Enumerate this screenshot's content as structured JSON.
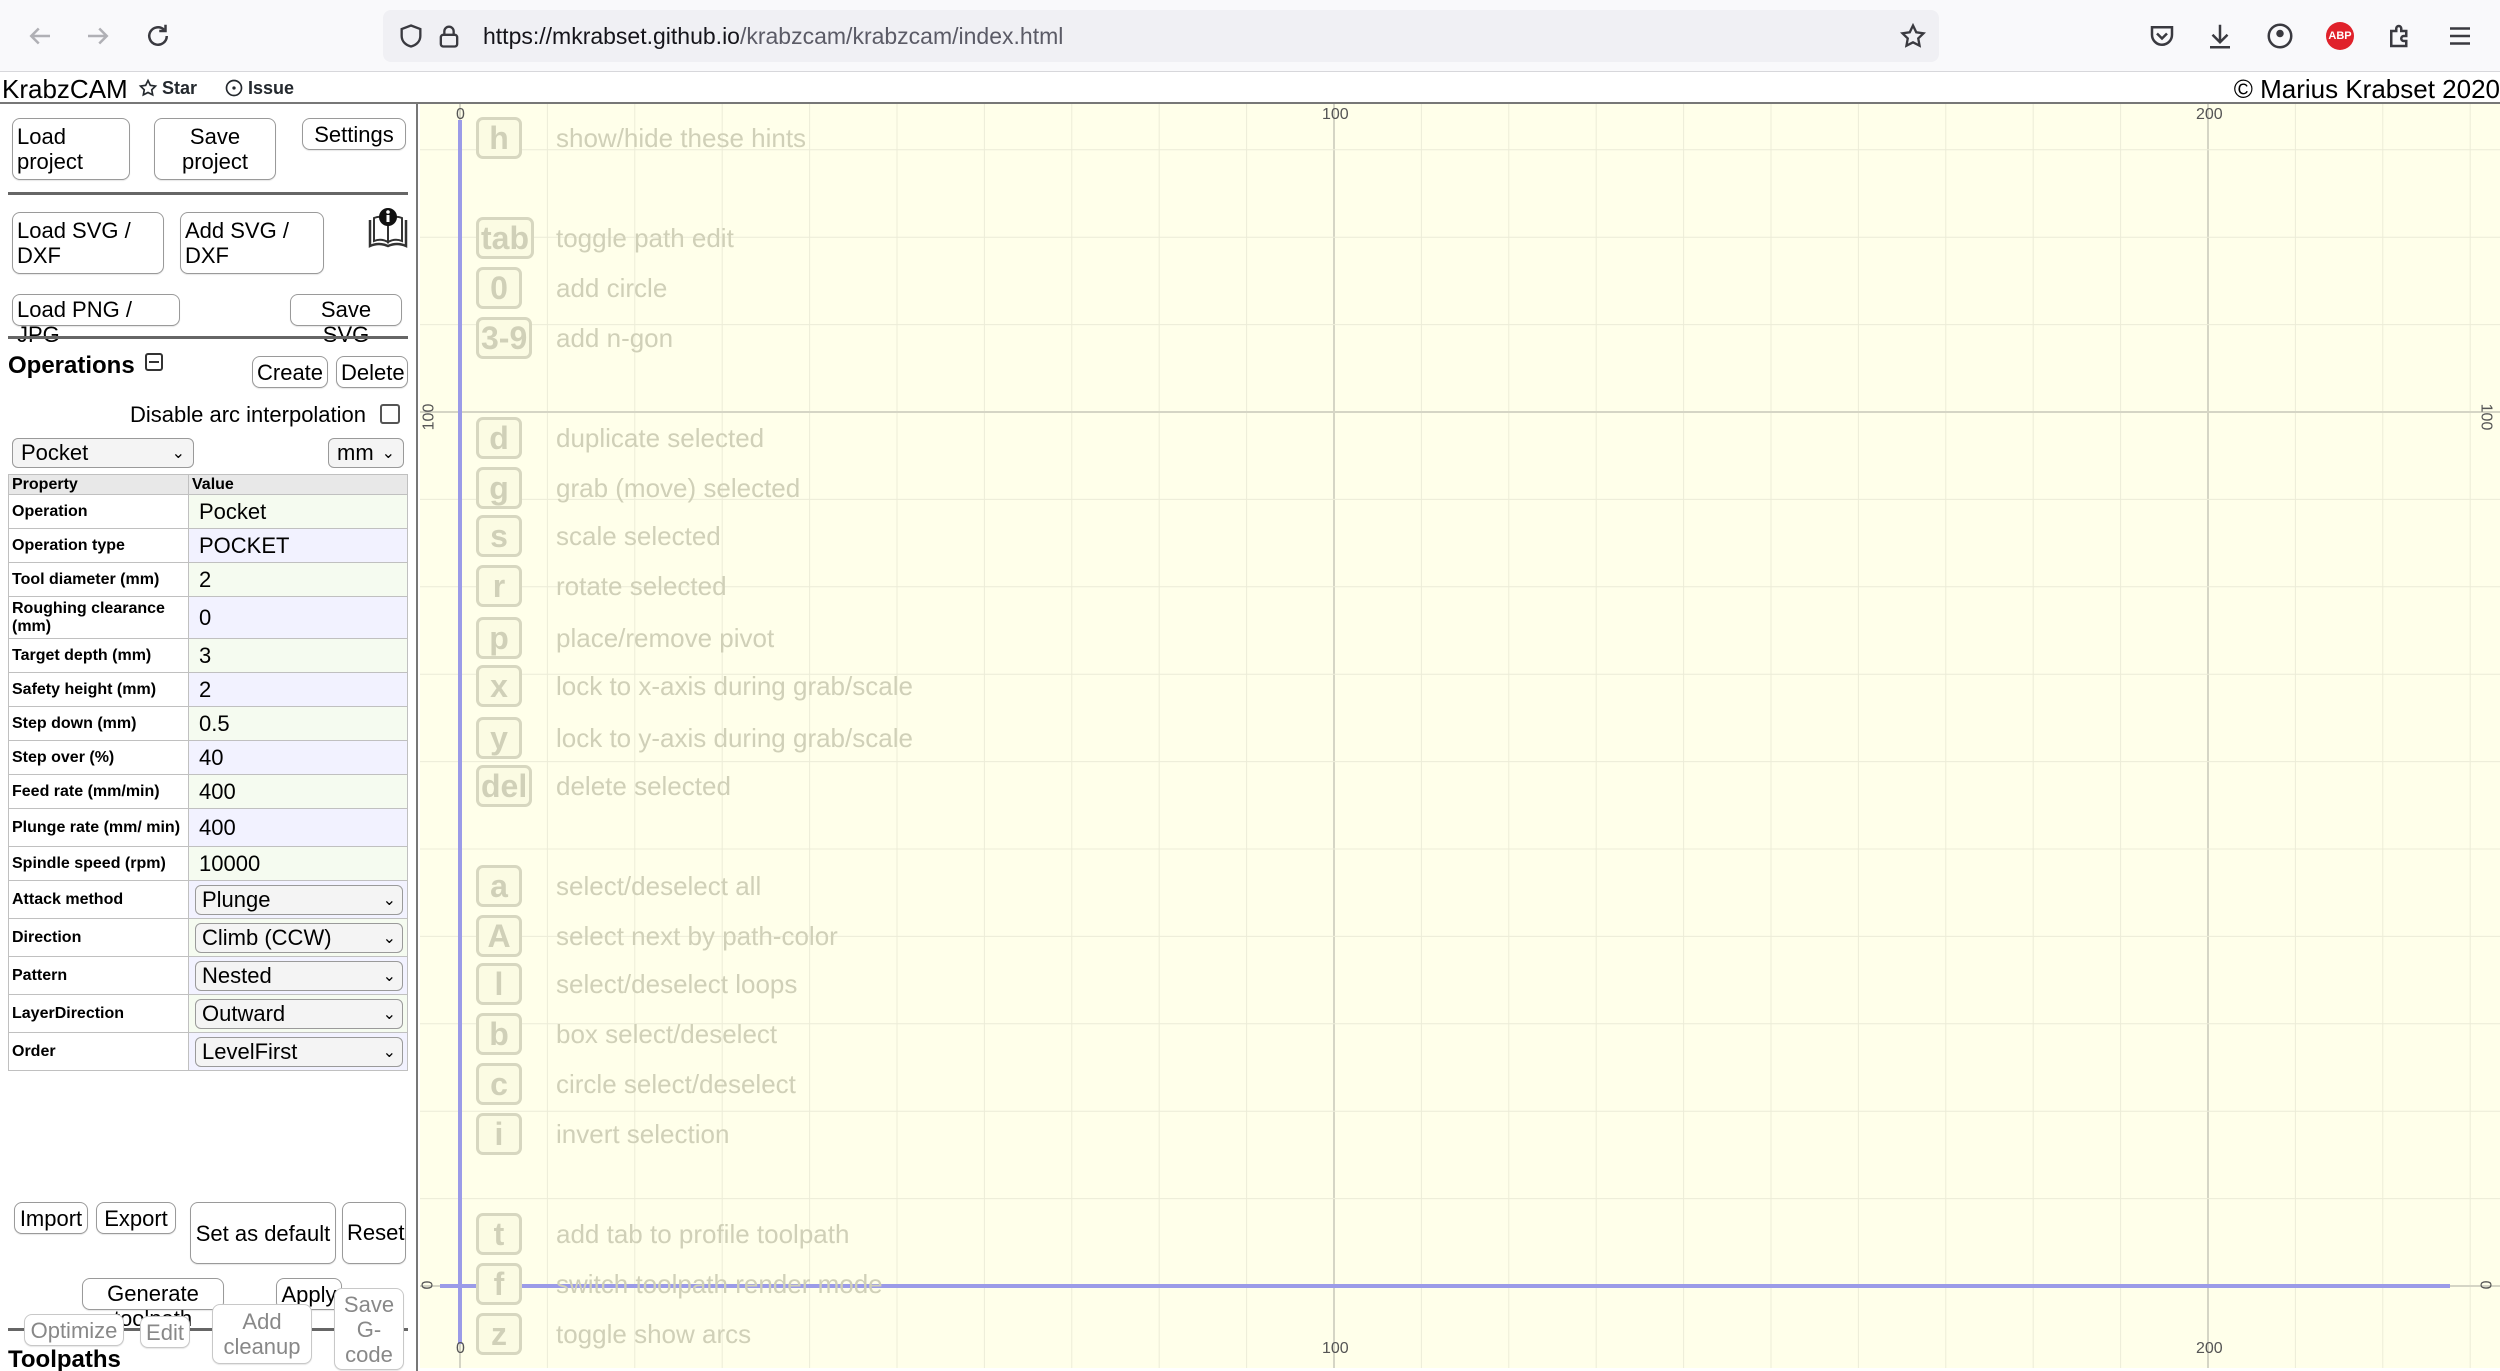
{
  "browser": {
    "url_host": "https://mkrabset.github.io",
    "url_path": "/krabzcam/krabzcam/index.html"
  },
  "header": {
    "app_title": "KrabzCAM",
    "star_label": "Star",
    "issue_label": "Issue",
    "copyright": "© Marius Krabset 2020"
  },
  "sidebar": {
    "load_project": "Load project",
    "save_project": "Save project",
    "settings": "Settings",
    "load_svg_dxf": "Load SVG / DXF",
    "add_svg_dxf": "Add SVG / DXF",
    "load_png_jpg": "Load PNG / JPG",
    "save_svg": "Save SVG",
    "operations_title": "Operations",
    "create": "Create",
    "delete": "Delete",
    "disable_arc_label": "Disable arc interpolation",
    "operation_select": "Pocket",
    "unit_select": "mm",
    "table_headers": {
      "property": "Property",
      "value": "Value"
    },
    "properties": [
      {
        "label": "Operation",
        "value": "Pocket",
        "kind": "input"
      },
      {
        "label": "Operation type",
        "value": "POCKET",
        "kind": "input"
      },
      {
        "label": "Tool diameter (mm)",
        "value": "2",
        "kind": "input"
      },
      {
        "label": "Roughing clearance (mm)",
        "value": "0",
        "kind": "input"
      },
      {
        "label": "Target depth (mm)",
        "value": "3",
        "kind": "input"
      },
      {
        "label": "Safety height (mm)",
        "value": "2",
        "kind": "input"
      },
      {
        "label": "Step down (mm)",
        "value": "0.5",
        "kind": "input"
      },
      {
        "label": "Step over (%)",
        "value": "40",
        "kind": "input"
      },
      {
        "label": "Feed rate (mm/min)",
        "value": "400",
        "kind": "input"
      },
      {
        "label": "Plunge rate (mm/ min)",
        "value": "400",
        "kind": "input"
      },
      {
        "label": "Spindle speed (rpm)",
        "value": "10000",
        "kind": "input"
      },
      {
        "label": "Attack method",
        "value": "Plunge",
        "kind": "select"
      },
      {
        "label": "Direction",
        "value": "Climb (CCW)",
        "kind": "select"
      },
      {
        "label": "Pattern",
        "value": "Nested",
        "kind": "select"
      },
      {
        "label": "LayerDirection",
        "value": "Outward",
        "kind": "select"
      },
      {
        "label": "Order",
        "value": "LevelFirst",
        "kind": "select"
      }
    ],
    "import": "Import",
    "export": "Export",
    "set_as_default": "Set as default",
    "reset": "Reset",
    "generate_toolpath": "Generate toolpath",
    "apply": "Apply",
    "toolpaths_title": "Toolpaths",
    "optimize": "Optimize",
    "edit": "Edit",
    "add_cleanup": "Add cleanup",
    "save_gcode": "Save G- code"
  },
  "canvas": {
    "hints": [
      {
        "key": "h",
        "text": "show/hide these hints"
      },
      {
        "key": "tab",
        "text": "toggle path edit"
      },
      {
        "key": "0",
        "text": "add circle"
      },
      {
        "key": "3-9",
        "text": "add n-gon"
      },
      {
        "key": "d",
        "text": "duplicate selected"
      },
      {
        "key": "g",
        "text": "grab (move) selected"
      },
      {
        "key": "s",
        "text": "scale selected"
      },
      {
        "key": "r",
        "text": "rotate selected"
      },
      {
        "key": "p",
        "text": "place/remove pivot"
      },
      {
        "key": "x",
        "text": "lock to x-axis during grab/scale"
      },
      {
        "key": "y",
        "text": "lock to y-axis during grab/scale"
      },
      {
        "key": "del",
        "text": "delete selected"
      },
      {
        "key": "a",
        "text": "select/deselect all"
      },
      {
        "key": "A",
        "text": "select next by path-color"
      },
      {
        "key": "l",
        "text": "select/deselect loops"
      },
      {
        "key": "b",
        "text": "box select/deselect"
      },
      {
        "key": "c",
        "text": "circle select/deselect"
      },
      {
        "key": "i",
        "text": "invert selection"
      },
      {
        "key": "t",
        "text": "add tab to profile toolpath"
      },
      {
        "key": "f",
        "text": "switch toolpath render mode"
      },
      {
        "key": "z",
        "text": "toggle show arcs"
      }
    ],
    "axis_labels": {
      "x0": "0",
      "x100": "100",
      "x200": "200",
      "y100": "100",
      "y0": "0"
    }
  }
}
